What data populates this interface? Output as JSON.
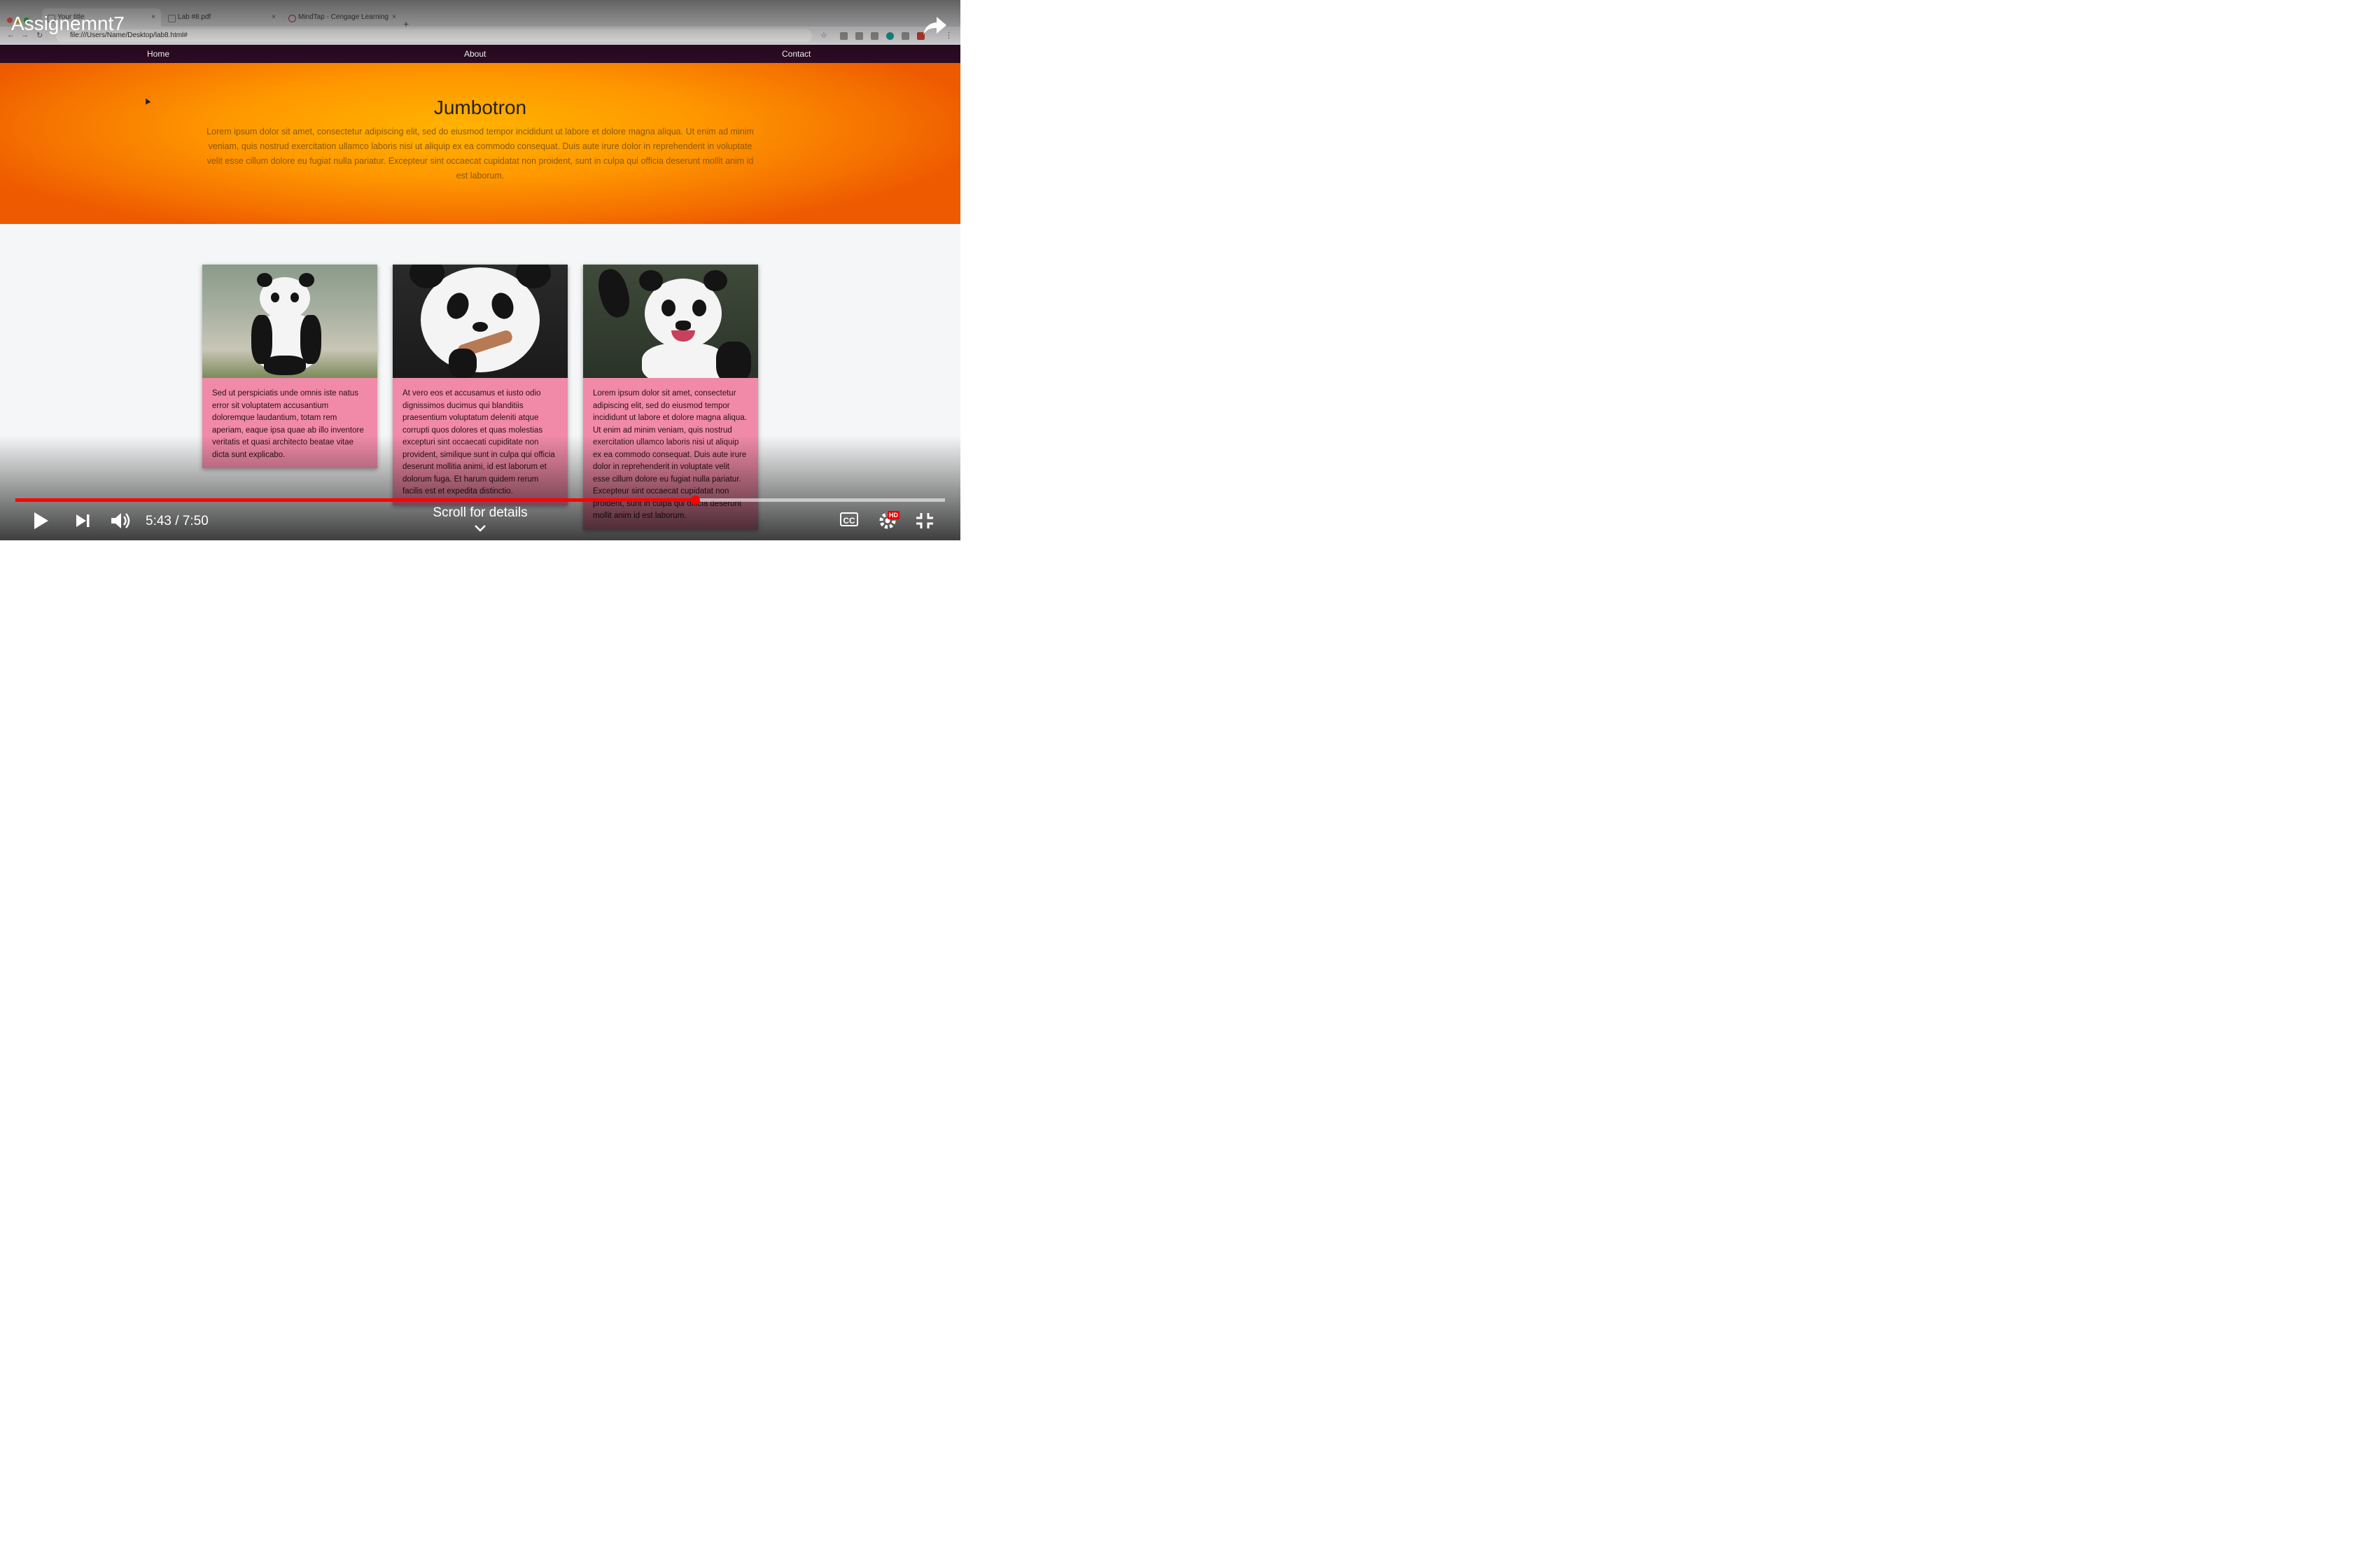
{
  "video": {
    "title": "Assignemnt7",
    "time": "5:43 / 7:50",
    "played_fraction": 0.731,
    "scroll_hint": "Scroll for details",
    "hd_badge": "HD",
    "cc_label": "CC"
  },
  "browser": {
    "tabs": [
      {
        "label": "Your title"
      },
      {
        "label": "Lab #8.pdf"
      },
      {
        "label": "MindTap - Cengage Learning"
      }
    ],
    "url": "file:///Users/Name/Desktop/lab8.html#"
  },
  "site": {
    "nav": [
      "Home",
      "About",
      "Contact"
    ],
    "jumbotron": {
      "title": "Jumbotron",
      "text": "Lorem ipsum dolor sit amet, consectetur adipiscing elit, sed do eiusmod tempor incididunt ut labore et dolore magna aliqua. Ut enim ad minim veniam, quis nostrud exercitation ullamco laboris nisi ut aliquip ex ea commodo consequat. Duis aute irure dolor in reprehenderit in voluptate velit esse cillum dolore eu fugiat nulla pariatur. Excepteur sint occaecat cupidatat non proident, sunt in culpa qui officia deserunt mollit anim id est laborum."
    },
    "cards": [
      {
        "text": "Sed ut perspiciatis unde omnis iste natus error sit voluptatem accusantium doloremque laudantium, totam rem aperiam, eaque ipsa quae ab illo inventore veritatis et quasi architecto beatae vitae dicta sunt explicabo."
      },
      {
        "text": "At vero eos et accusamus et iusto odio dignissimos ducimus qui blanditiis praesentium voluptatum deleniti atque corrupti quos dolores et quas molestias excepturi sint occaecati cupiditate non provident, similique sunt in culpa qui officia deserunt mollitia animi, id est laborum et dolorum fuga. Et harum quidem rerum facilis est et expedita distinctio."
      },
      {
        "text": "Lorem ipsum dolor sit amet, consectetur adipiscing elit, sed do eiusmod tempor incididunt ut labore et dolore magna aliqua. Ut enim ad minim veniam, quis nostrud exercitation ullamco laboris nisi ut aliquip ex ea commodo consequat. Duis aute irure dolor in reprehenderit in voluptate velit esse cillum dolore eu fugiat nulla pariatur. Excepteur sint occaecat cupidatat non proident, sunt in culpa qui officia deserunt mollit anim id est laborum."
      }
    ]
  },
  "colors": {
    "nav_bg": "#2d0b24",
    "jumbotron_orange": "#ff9800",
    "card_pink": "#f08aa8",
    "progress_red": "#ff0000"
  },
  "icons": [
    "play-icon",
    "next-icon",
    "volume-icon",
    "cc-icon",
    "settings-icon",
    "fullscreen-exit-icon",
    "share-icon",
    "chevron-down-icon"
  ]
}
